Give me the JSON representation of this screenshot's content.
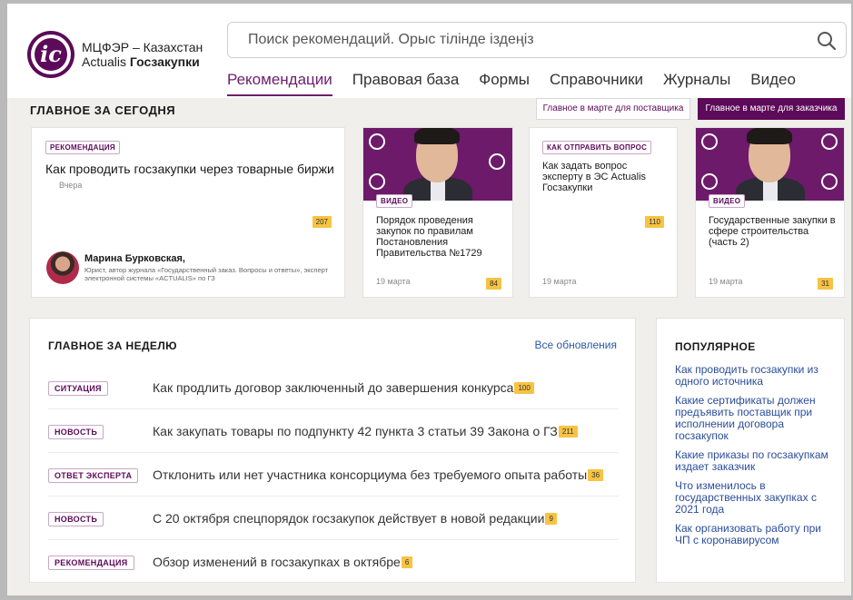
{
  "brand": {
    "line1": "МЦФЭР – Казахстан",
    "line2a": "Actualis ",
    "line2b": "Госзакупки"
  },
  "search": {
    "placeholder": "Поиск рекомендаций. Орыс тілінде іздеңіз"
  },
  "nav": [
    "Рекомендации",
    "Правовая база",
    "Формы",
    "Справочники",
    "Журналы",
    "Видео"
  ],
  "today": {
    "title": "ГЛАВНОЕ ЗА СЕГОДНЯ",
    "tab_supplier": "Главное в марте для поставщика",
    "tab_customer": "Главное в марте для заказчика",
    "big_card": {
      "tag": "РЕКОМЕНДАЦИЯ",
      "title": "Как проводить госзакупки через товарные биржи",
      "date": "Вчера",
      "count": "207",
      "author_name": "Марина Бурковская",
      "author_desc": "Юрист, автор журнала «Государственный заказ. Вопросы и ответы», эксперт электронной системы «ACTUALIS» по ГЗ"
    },
    "video1": {
      "tag": "ВИДЕО",
      "title": "Порядок проведения закупок по правилам Постановления Правительства №1729",
      "date": "19 марта",
      "count": "84"
    },
    "question": {
      "tag": "КАК ОТПРАВИТЬ ВОПРОС",
      "title": "Как задать вопрос эксперту в ЭС Actualis Госзакупки",
      "date": "19 марта",
      "count": "110"
    },
    "video2": {
      "tag": "ВИДЕО",
      "title": "Государственные закупки в сфере строительства (часть 2)",
      "date": "19 марта",
      "count": "31"
    }
  },
  "week": {
    "title": "ГЛАВНОЕ ЗА НЕДЕЛЮ",
    "all_link": "Все обновления",
    "rows": [
      {
        "tag": "СИТУАЦИЯ",
        "title": "Как продлить договор заключенный до завершения конкурса",
        "count": "100"
      },
      {
        "tag": "НОВОСТЬ",
        "title": "Как закупать товары по подпункту 42 пункта 3 статьи 39 Закона о ГЗ",
        "count": "211"
      },
      {
        "tag": "ОТВЕТ ЭКСПЕРТА",
        "title": "Отклонить или нет участника консорциума без требуемого опыта работы",
        "count": "36"
      },
      {
        "tag": "НОВОСТЬ",
        "title": "С 20 октября спецпорядок госзакупок действует в новой редакции",
        "count": "9"
      },
      {
        "tag": "РЕКОМЕНДАЦИЯ",
        "title": "Обзор изменений в госзакупках в октябре",
        "count": "6"
      }
    ]
  },
  "popular": {
    "title": "ПОПУЛЯРНОЕ",
    "items": [
      "Как проводить госзакупки из одного источника",
      "Какие сертификаты должен предъявить поставщик при исполнении договора госзакупок",
      "Какие приказы по госзакупкам издает заказчик",
      "Что изменилось в государственных закупках с 2021 года",
      "Как организовать работу при ЧП с коронавирусом"
    ]
  },
  "colors": {
    "brand_purple": "#5c0a59",
    "count_badge": "#f6c343",
    "link_blue": "#2a5aa6"
  }
}
